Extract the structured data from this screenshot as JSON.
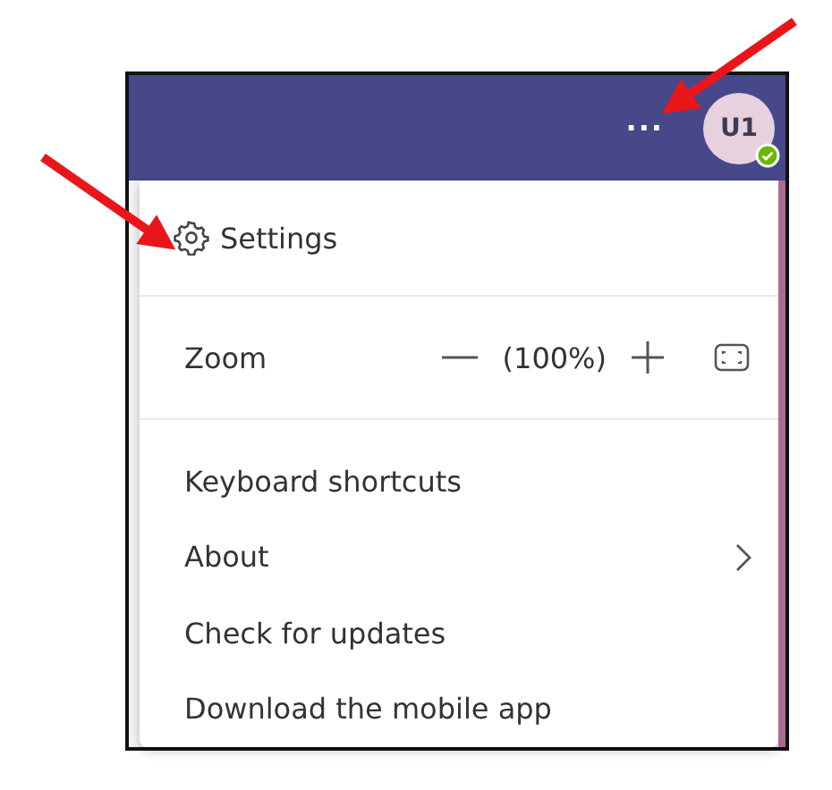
{
  "header": {
    "more_label": "...",
    "avatar": {
      "initials": "U1"
    }
  },
  "menu": [
    {
      "kind": "icon_item",
      "label": "Settings"
    },
    {
      "kind": "zoom",
      "label": "Zoom",
      "value": "(100%)"
    },
    {
      "kind": "item",
      "label": "Keyboard shortcuts",
      "submenu": false
    },
    {
      "kind": "item",
      "label": "About",
      "submenu": true
    },
    {
      "kind": "item",
      "label": "Check for updates",
      "submenu": false
    },
    {
      "kind": "item",
      "label": "Download the mobile app",
      "submenu": false
    }
  ],
  "annotations": [
    {
      "kind": "arrow"
    },
    {
      "kind": "arrow"
    }
  ]
}
